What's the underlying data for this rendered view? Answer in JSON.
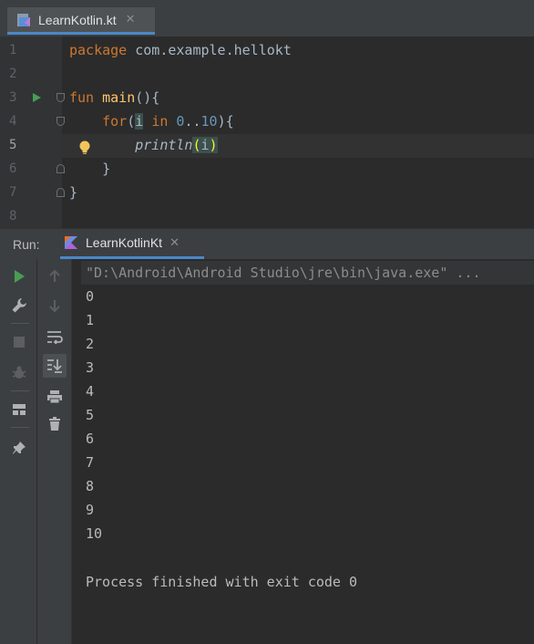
{
  "editor_tab": {
    "filename": "LearnKotlin.kt",
    "close": "✕"
  },
  "editor": {
    "line_numbers": [
      "1",
      "2",
      "3",
      "4",
      "5",
      "6",
      "7",
      "8"
    ],
    "lines": {
      "l1_kw": "package",
      "l1_rest": " com.example.hellokt",
      "l3_kw": "fun",
      "l3_fn": "main",
      "l3_rest": "(){",
      "l4_indent": "    ",
      "l4_kw": "for",
      "l4_p1": "(",
      "l4_var": "i",
      "l4_sp": " ",
      "l4_in": "in",
      "l4_sp2": " ",
      "l4_n1": "0",
      "l4_dots": "..",
      "l4_n2": "10",
      "l4_end": "){",
      "l5_indent": "        ",
      "l5_fn": "println",
      "l5_p1": "(",
      "l5_arg": "i",
      "l5_p2": ")",
      "l6": "    }",
      "l7": "}"
    }
  },
  "run_panel": {
    "label": "Run:",
    "tab_name": "LearnKotlinKt",
    "tab_close": "✕",
    "command": "\"D:\\Android\\Android Studio\\jre\\bin\\java.exe\" ...",
    "output": [
      "0",
      "1",
      "2",
      "3",
      "4",
      "5",
      "6",
      "7",
      "8",
      "9",
      "10"
    ],
    "finish": "Process finished with exit code 0"
  },
  "colors": {
    "keyword": "#cc7832",
    "function": "#ffc66d",
    "number": "#6897bb",
    "run_green": "#499c54",
    "accent": "#4a88c7"
  },
  "icons": [
    "kotlin-file-icon",
    "run-gutter-icon",
    "fold-icon",
    "bulb-icon",
    "run-icon",
    "wrench-icon",
    "stop-icon",
    "debug-icon",
    "layout-icon",
    "pin-icon",
    "up-arrow-icon",
    "down-arrow-icon",
    "soft-wrap-icon",
    "scroll-to-end-icon",
    "print-icon",
    "trash-icon"
  ]
}
